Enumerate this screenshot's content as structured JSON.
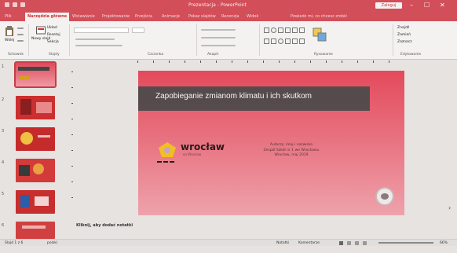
{
  "titlebar": {
    "title": "Prezentacja - PowerPoint",
    "signin": "Zaloguj",
    "minimize": "–",
    "maximize": "☐",
    "close": "✕"
  },
  "tabs": [
    {
      "label": "Plik"
    },
    {
      "label": "Narzędzia główne"
    },
    {
      "label": "Wstawianie"
    },
    {
      "label": "Projektowanie"
    },
    {
      "label": "Przejścia"
    },
    {
      "label": "Animacje"
    },
    {
      "label": "Pokaz slajdów"
    },
    {
      "label": "Recenzja"
    },
    {
      "label": "Widok"
    },
    {
      "label": "Powiedz mi, co chcesz zrobić"
    }
  ],
  "ribbon": {
    "groups": [
      {
        "label": "Schowek"
      },
      {
        "label": "Slajdy"
      },
      {
        "label": "Czcionka"
      },
      {
        "label": "Akapit"
      },
      {
        "label": "Rysowanie"
      },
      {
        "label": "Edytowanie"
      }
    ],
    "paste": "Wklej",
    "new_slide": "Nowy slajd",
    "layout": "Układ",
    "reset": "Resetuj",
    "section": "Sekcja",
    "find": "Znajdź",
    "replace": "Zamień",
    "select": "Zaznacz"
  },
  "slides": [
    {
      "num": "1"
    },
    {
      "num": "2"
    },
    {
      "num": "3"
    },
    {
      "num": "4"
    },
    {
      "num": "5"
    },
    {
      "num": "6"
    }
  ],
  "slide": {
    "title": "Zapobieganie zmianom klimatu i ich skutkom",
    "logo": "wrocław",
    "logo_sub": "eu Wrocław",
    "info_lines": [
      "Autorzy: imię i nazwisko",
      "Zespół Szkół nr 1 we Wrocławiu",
      "Wrocław, maj 2019"
    ]
  },
  "notes_label": "Kliknij, aby dodać notatki",
  "status": {
    "slide_counter": "Slajd 1 z 6",
    "language": "polski",
    "notes_btn": "Notatki",
    "comments_btn": "Komentarze",
    "zoom": "66%"
  },
  "colors": {
    "accent": "#d24e58",
    "ribbon_bg": "#f3f2f1",
    "workspace_bg": "#e6e3e1"
  }
}
